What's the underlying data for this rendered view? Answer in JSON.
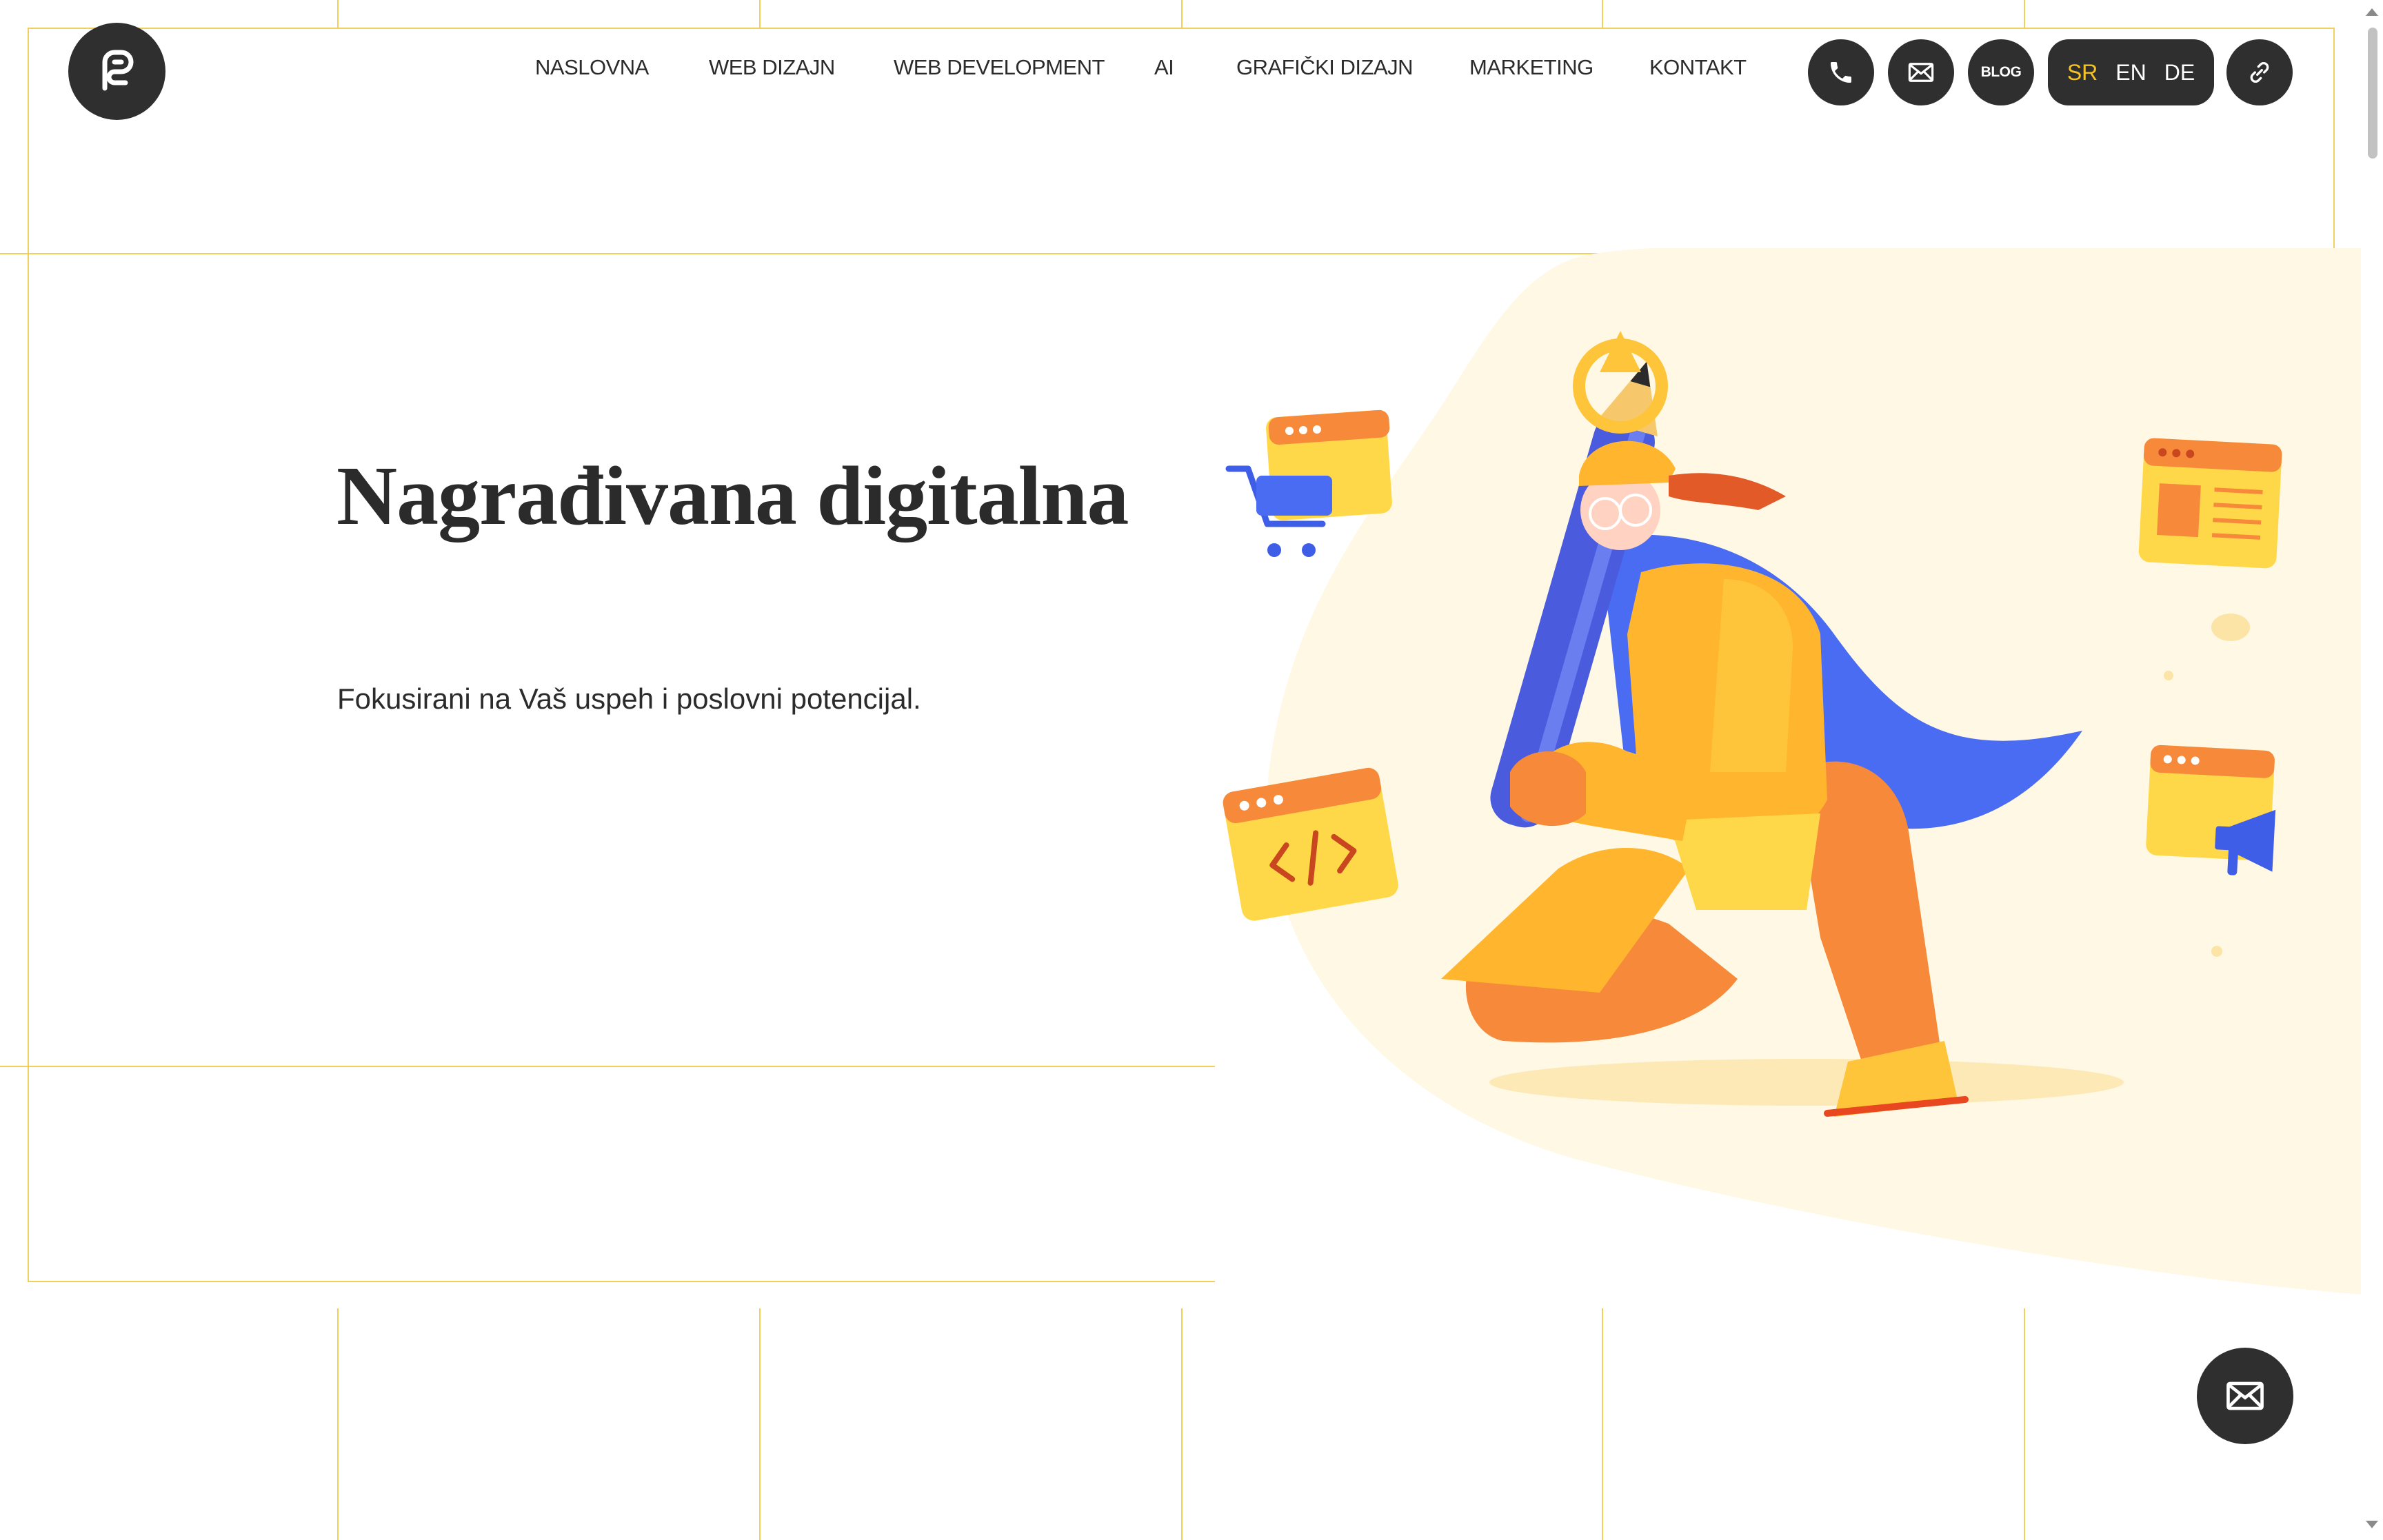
{
  "header": {
    "logo_icon": "brand-p-logo",
    "nav": [
      {
        "label": "NASLOVNA"
      },
      {
        "label": "WEB DIZAJN"
      },
      {
        "label": "WEB DEVELOPMENT"
      },
      {
        "label": "AI"
      },
      {
        "label": "GRAFIČKI DIZAJN"
      },
      {
        "label": "MARKETING"
      },
      {
        "label": "KONTAKT"
      }
    ],
    "buttons": {
      "phone_icon": "phone-icon",
      "mail_icon": "mail-icon",
      "blog_label": "BLOG",
      "link_icon": "link-icon"
    },
    "languages": [
      {
        "code": "SR",
        "active": true
      },
      {
        "code": "EN",
        "active": false
      },
      {
        "code": "DE",
        "active": false
      }
    ]
  },
  "hero": {
    "title": "Nagrađivana digitalna",
    "subtitle": "Fokusirani na Vaš uspeh i poslovni potencijal."
  },
  "floating_contact_icon": "mail-icon",
  "colors": {
    "accent": "#f5c423",
    "grid_line": "#f2cf5a",
    "dark": "#2f2f2f",
    "orange": "#f7893a",
    "blue": "#4a6cf2",
    "yellow": "#ffd84a",
    "cream": "#fff8e4"
  }
}
